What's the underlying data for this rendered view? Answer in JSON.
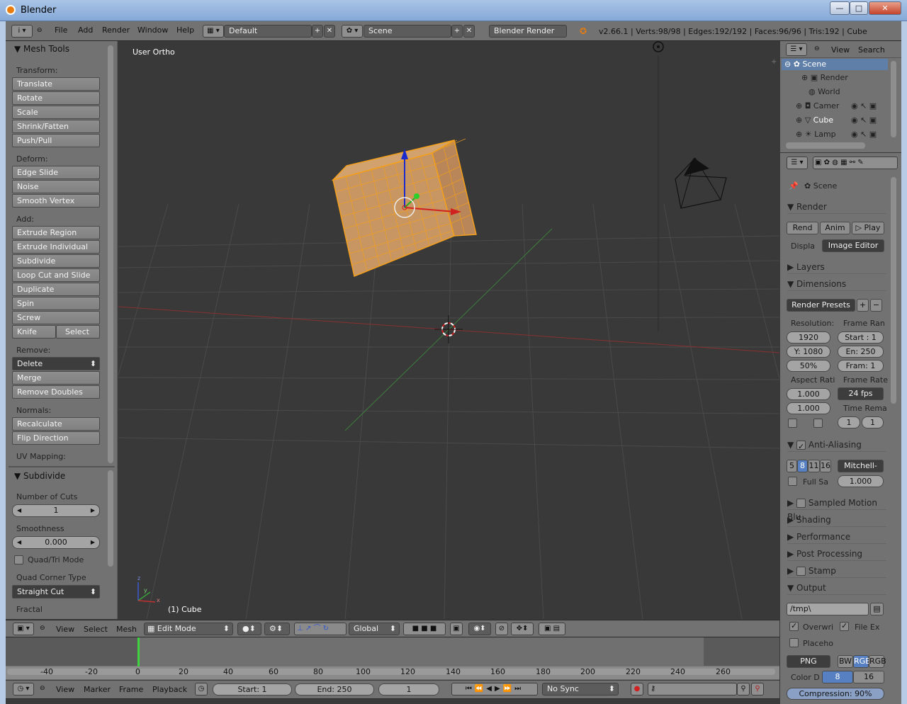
{
  "window": {
    "title": "Blender",
    "min": "—",
    "max": "□",
    "close": "✕"
  },
  "topbar": {
    "menus": [
      "File",
      "Add",
      "Render",
      "Window",
      "Help"
    ],
    "layout": "Default",
    "scene": "Scene",
    "engine": "Blender Render",
    "stats": "v2.66.1 | Verts:98/98 | Edges:192/192 | Faces:96/96 | Tris:192 | Cube"
  },
  "tools": {
    "title": "Mesh Tools",
    "transform_label": "Transform:",
    "transform": [
      "Translate",
      "Rotate",
      "Scale",
      "Shrink/Fatten",
      "Push/Pull"
    ],
    "deform_label": "Deform:",
    "deform": [
      "Edge Slide",
      "Noise",
      "Smooth Vertex"
    ],
    "add_label": "Add:",
    "add": [
      "Extrude Region",
      "Extrude Individual",
      "Subdivide",
      "Loop Cut and Slide",
      "Duplicate",
      "Spin",
      "Screw"
    ],
    "knife": "Knife",
    "select": "Select",
    "remove_label": "Remove:",
    "delete": "Delete",
    "remove": [
      "Merge",
      "Remove Doubles"
    ],
    "normals_label": "Normals:",
    "normals": [
      "Recalculate",
      "Flip Direction"
    ],
    "uv_label": "UV Mapping:"
  },
  "operator": {
    "title": "Subdivide",
    "cuts_label": "Number of Cuts",
    "cuts": "1",
    "smooth_label": "Smoothness",
    "smooth": "0.000",
    "quadtri": "Quad/Tri Mode",
    "corner_label": "Quad Corner Type",
    "corner": "Straight Cut",
    "fractal_label": "Fractal"
  },
  "viewport": {
    "view_label": "User Ortho",
    "object_label": "(1) Cube",
    "axis_z": "z",
    "axis_y": "y",
    "axis_x": "x"
  },
  "view3d_header": {
    "menus": [
      "View",
      "Select",
      "Mesh"
    ],
    "mode": "Edit Mode",
    "orientation": "Global"
  },
  "outliner": {
    "menus": [
      "View",
      "Search"
    ],
    "items": [
      "Scene",
      "Render",
      "World",
      "Camer",
      "Cube",
      "Lamp"
    ]
  },
  "properties": {
    "scene": "Scene",
    "render_header": "Render",
    "render_btn": "Rend",
    "anim_btn": "Anim",
    "play_btn": "Play",
    "display_label": "Displa",
    "display": "Image Editor",
    "layers": "Layers",
    "dimensions": "Dimensions",
    "presets": "Render Presets",
    "resolution_label": "Resolution:",
    "res_x": "1920",
    "res_y": "Y: 1080",
    "res_pct": "50%",
    "frame_range_label": "Frame Ran",
    "start": "Start : 1",
    "end": "En: 250",
    "step": "Fram: 1",
    "aspect_label": "Aspect Rati",
    "aspect_x": "1.000",
    "aspect_y": "1.000",
    "frame_rate_label": "Frame Rate",
    "fps": "24 fps",
    "time_remap_label": "Time Rema",
    "remap_old": "1",
    "remap_new": "1",
    "aa": "Anti-Aliasing",
    "aa_samples": [
      "5",
      "8",
      "11",
      "16"
    ],
    "aa_filter": "Mitchell-",
    "full_sample": "Full Sa",
    "aa_size": "1.000",
    "motion_blur": "Sampled Motion Blu",
    "shading": "Shading",
    "performance": "Performance",
    "post": "Post Processing",
    "stamp": "Stamp",
    "output": "Output",
    "path": "/tmp\\",
    "overwrite": "Overwri",
    "file_ext": "File Ex",
    "placeholders": "Placeho",
    "format": "PNG",
    "color_modes": [
      "BW",
      "RGB",
      "RGB"
    ],
    "color_depth_label": "Color D",
    "depths": [
      "8",
      "16"
    ],
    "compression": "Compression: 90%"
  },
  "timeline": {
    "ticks": [
      "-40",
      "-20",
      "0",
      "20",
      "40",
      "60",
      "80",
      "100",
      "120",
      "140",
      "160",
      "180",
      "200",
      "220",
      "240",
      "260"
    ]
  },
  "bottombar": {
    "menus": [
      "View",
      "Marker",
      "Frame",
      "Playback"
    ],
    "start": "Start: 1",
    "end": "End: 250",
    "current": "1",
    "sync": "No Sync"
  }
}
